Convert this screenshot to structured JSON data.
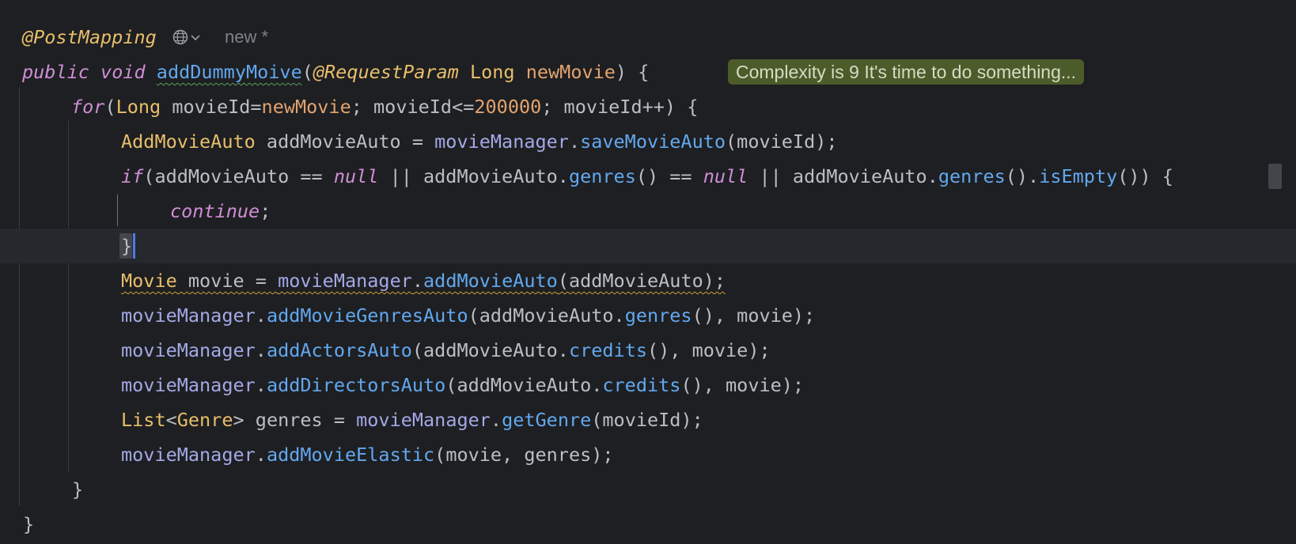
{
  "editor": {
    "annotation_line": {
      "annotation": "@PostMapping",
      "globe_icon": "globe-icon",
      "chevron_icon": "chevron-down-icon",
      "new_label": "new *"
    },
    "signature": {
      "public": "public",
      "void": "void",
      "method_name": "addDummyMoive",
      "open_paren": "(",
      "request_param": "@RequestParam",
      "param_type": "Long",
      "param_name": "newMovie",
      "close": ") {",
      "inlay_hint": "Complexity is 9 It's time to do something..."
    },
    "for_line": {
      "keyword": "for",
      "p1": "(",
      "type": "Long",
      "p2": " movieId=",
      "var": "newMovie",
      "p3": "; movieId<=",
      "num": "200000",
      "p4": "; movieId++) {"
    },
    "save_line": {
      "type": "AddMovieAuto",
      "p1": " addMovieAuto = ",
      "field": "movieManager",
      "dot": ".",
      "method": "saveMovieAuto",
      "p2": "(movieId);"
    },
    "if_line": {
      "keyword": "if",
      "p1": "(addMovieAuto == ",
      "null1": "null",
      "p2": " || addMovieAuto.",
      "m1": "genres",
      "p3": "() == ",
      "null2": "null",
      "p4": " || addMovieAuto.",
      "m2": "genres",
      "p5": "().",
      "m3": "isEmpty",
      "p6": "()) ",
      "brace": "{"
    },
    "continue_line": {
      "keyword": "continue",
      "semi": ";"
    },
    "close_if_line": {
      "brace": "}"
    },
    "movie_line": {
      "type": "Movie",
      "p1": " movie = ",
      "field": "movieManager",
      "dot": ".",
      "method": "addMovieAuto",
      "p2": "(addMovieAuto);"
    },
    "genres_auto_line": {
      "field": "movieManager",
      "dot": ".",
      "method": "addMovieGenresAuto",
      "p1": "(addMovieAuto.",
      "m1": "genres",
      "p2": "(), movie);"
    },
    "actors_line": {
      "field": "movieManager",
      "dot": ".",
      "method": "addActorsAuto",
      "p1": "(addMovieAuto.",
      "m1": "credits",
      "p2": "(), movie);"
    },
    "directors_line": {
      "field": "movieManager",
      "dot": ".",
      "method": "addDirectorsAuto",
      "p1": "(addMovieAuto.",
      "m1": "credits",
      "p2": "(), movie);"
    },
    "list_line": {
      "type1": "List",
      "lt": "<",
      "type2": "Genre",
      "p1": "> genres = ",
      "field": "movieManager",
      "dot": ".",
      "method": "getGenre",
      "p2": "(movieId);"
    },
    "elastic_line": {
      "field": "movieManager",
      "dot": ".",
      "method": "addMovieElastic",
      "p1": "(movie, genres);"
    },
    "close_for_line": {
      "brace": "}"
    },
    "close_method_line": {
      "brace": "}"
    }
  },
  "colors": {
    "background": "#1e1f22",
    "current_line": "#26282e",
    "keyword": "#cf8ed6",
    "annotation": "#e8bf6a",
    "field": "#a3a9e6",
    "method": "#62a8f0",
    "number": "#e2a36f",
    "inlay_bg": "#4c5b2a"
  }
}
